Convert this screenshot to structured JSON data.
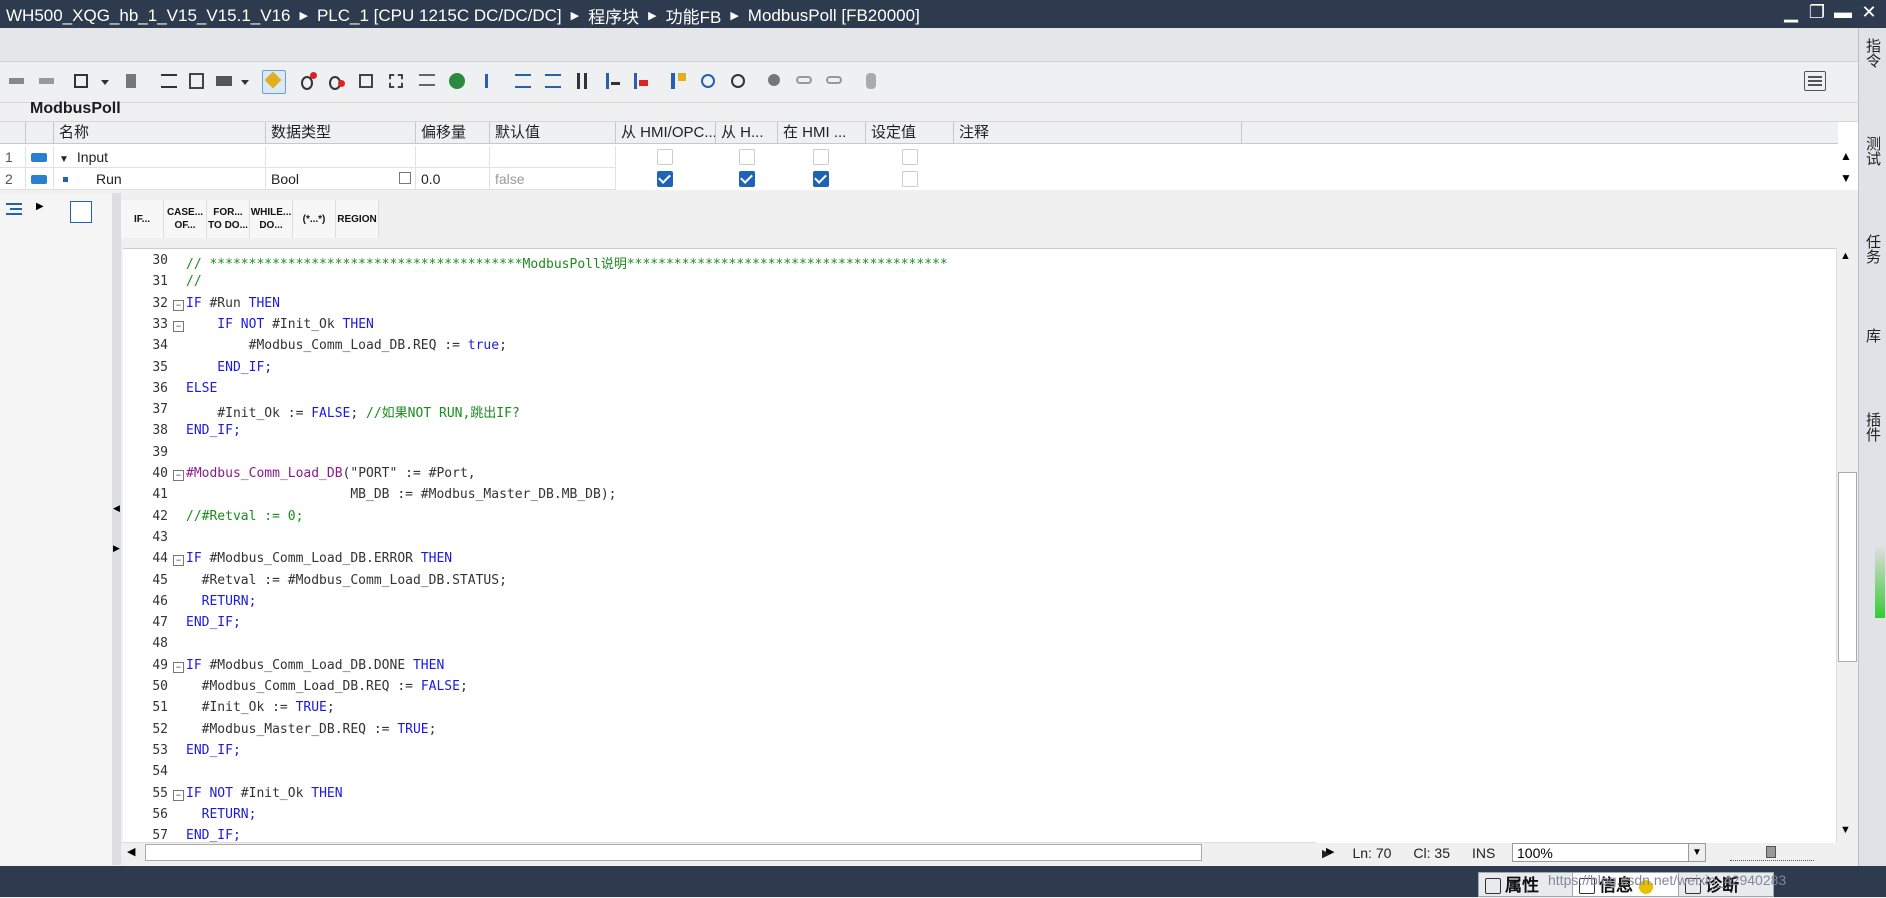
{
  "titlebar": {
    "breadcrumb": [
      "WH500_XQG_hb_1_V15_V15.1_V16",
      "PLC_1 [CPU 1215C DC/DC/DC]",
      "程序块",
      "功能FB",
      "ModbusPoll [FB20000]"
    ]
  },
  "block_name": "ModbusPoll",
  "interface": {
    "columns": [
      "名称",
      "数据类型",
      "偏移量",
      "默认值",
      "从 HMI/OPC...",
      "从 H...",
      "在 HMI ...",
      "设定值",
      "注释"
    ],
    "rows": [
      {
        "num": "1",
        "name": "Input",
        "type": "",
        "offset": "",
        "default": "",
        "hmi_opc": false,
        "from_h": false,
        "in_hmi": false,
        "setpoint": false
      },
      {
        "num": "2",
        "name": "Run",
        "type": "Bool",
        "offset": "0.0",
        "default": "false",
        "hmi_opc": true,
        "from_h": true,
        "in_hmi": true,
        "setpoint": false
      }
    ]
  },
  "snippets": [
    "IF...",
    "CASE...\nOF...",
    "FOR...\nTO DO...",
    "WHILE...\nDO...",
    "(*...*)",
    "REGION"
  ],
  "code": {
    "lines": [
      {
        "n": "30",
        "fold": "",
        "parts": [
          {
            "t": "// ****************************************ModbusPoll说明*****************************************",
            "c": "c"
          }
        ]
      },
      {
        "n": "31",
        "fold": "",
        "parts": [
          {
            "t": "//",
            "c": "c"
          }
        ]
      },
      {
        "n": "32",
        "fold": "−",
        "parts": [
          {
            "t": "IF ",
            "c": "k"
          },
          {
            "t": "#Run ",
            "c": "v"
          },
          {
            "t": "THEN",
            "c": "k"
          }
        ]
      },
      {
        "n": "33",
        "fold": "−",
        "parts": [
          {
            "t": "    IF NOT ",
            "c": "k"
          },
          {
            "t": "#Init_Ok ",
            "c": "v"
          },
          {
            "t": "THEN",
            "c": "k"
          }
        ]
      },
      {
        "n": "34",
        "fold": "",
        "parts": [
          {
            "t": "        #Modbus_Comm_Load_DB.REQ := ",
            "c": "v"
          },
          {
            "t": "true",
            "c": "k"
          },
          {
            "t": ";",
            "c": "v"
          }
        ]
      },
      {
        "n": "35",
        "fold": "",
        "parts": [
          {
            "t": "    END_IF;",
            "c": "k"
          }
        ]
      },
      {
        "n": "36",
        "fold": "",
        "parts": [
          {
            "t": "ELSE",
            "c": "k"
          }
        ]
      },
      {
        "n": "37",
        "fold": "",
        "parts": [
          {
            "t": "    #Init_Ok := ",
            "c": "v"
          },
          {
            "t": "FALSE",
            "c": "k"
          },
          {
            "t": "; ",
            "c": "v"
          },
          {
            "t": "//如果NOT RUN,跳出IF?",
            "c": "c"
          }
        ]
      },
      {
        "n": "38",
        "fold": "",
        "parts": [
          {
            "t": "END_IF;",
            "c": "k"
          }
        ]
      },
      {
        "n": "39",
        "fold": "",
        "parts": []
      },
      {
        "n": "40",
        "fold": "−",
        "parts": [
          {
            "t": "#Modbus_Comm_Load_DB",
            "c": "f"
          },
          {
            "t": "(\"PORT\" := #Port,",
            "c": "v"
          }
        ]
      },
      {
        "n": "41",
        "fold": "",
        "parts": [
          {
            "t": "                     MB_DB := #Modbus_Master_DB.MB_DB);",
            "c": "v"
          }
        ]
      },
      {
        "n": "42",
        "fold": "",
        "parts": [
          {
            "t": "//#Retval := 0;",
            "c": "c"
          }
        ]
      },
      {
        "n": "43",
        "fold": "",
        "parts": []
      },
      {
        "n": "44",
        "fold": "−",
        "parts": [
          {
            "t": "IF ",
            "c": "k"
          },
          {
            "t": "#Modbus_Comm_Load_DB.ERROR ",
            "c": "v"
          },
          {
            "t": "THEN",
            "c": "k"
          }
        ]
      },
      {
        "n": "45",
        "fold": "",
        "parts": [
          {
            "t": "  #Retval := #Modbus_Comm_Load_DB.STATUS;",
            "c": "v"
          }
        ]
      },
      {
        "n": "46",
        "fold": "",
        "parts": [
          {
            "t": "  RETURN;",
            "c": "k"
          }
        ]
      },
      {
        "n": "47",
        "fold": "",
        "parts": [
          {
            "t": "END_IF;",
            "c": "k"
          }
        ]
      },
      {
        "n": "48",
        "fold": "",
        "parts": []
      },
      {
        "n": "49",
        "fold": "−",
        "parts": [
          {
            "t": "IF ",
            "c": "k"
          },
          {
            "t": "#Modbus_Comm_Load_DB.DONE ",
            "c": "v"
          },
          {
            "t": "THEN",
            "c": "k"
          }
        ]
      },
      {
        "n": "50",
        "fold": "",
        "parts": [
          {
            "t": "  #Modbus_Comm_Load_DB.REQ := ",
            "c": "v"
          },
          {
            "t": "FALSE",
            "c": "k"
          },
          {
            "t": ";",
            "c": "v"
          }
        ]
      },
      {
        "n": "51",
        "fold": "",
        "parts": [
          {
            "t": "  #Init_Ok := ",
            "c": "v"
          },
          {
            "t": "TRUE",
            "c": "k"
          },
          {
            "t": ";",
            "c": "v"
          }
        ]
      },
      {
        "n": "52",
        "fold": "",
        "parts": [
          {
            "t": "  #Modbus_Master_DB.REQ := ",
            "c": "v"
          },
          {
            "t": "TRUE",
            "c": "k"
          },
          {
            "t": ";",
            "c": "v"
          }
        ]
      },
      {
        "n": "53",
        "fold": "",
        "parts": [
          {
            "t": "END_IF;",
            "c": "k"
          }
        ]
      },
      {
        "n": "54",
        "fold": "",
        "parts": []
      },
      {
        "n": "55",
        "fold": "−",
        "parts": [
          {
            "t": "IF NOT ",
            "c": "k"
          },
          {
            "t": "#Init_Ok ",
            "c": "v"
          },
          {
            "t": "THEN",
            "c": "k"
          }
        ]
      },
      {
        "n": "56",
        "fold": "",
        "parts": [
          {
            "t": "  RETURN;",
            "c": "k"
          }
        ]
      },
      {
        "n": "57",
        "fold": "",
        "parts": [
          {
            "t": "END_IF;",
            "c": "k"
          }
        ]
      }
    ]
  },
  "status": {
    "ln": "Ln: 70",
    "cl": "Cl: 35",
    "mode": "INS",
    "zoom": "100%"
  },
  "right_sidebar": [
    "指令",
    "测试",
    "任务",
    "库",
    "插件"
  ],
  "bottom_tabs": [
    "属性",
    "信息",
    "诊断"
  ],
  "watermark": "https://blog.csdn.net/weixin_42940283",
  "colors": {
    "titlebar": "#2e3b4e",
    "keyword": "#1a1ae0",
    "comment": "#1a8c1a",
    "call": "#8b1a8b",
    "checkbox": "#1e63b8"
  }
}
